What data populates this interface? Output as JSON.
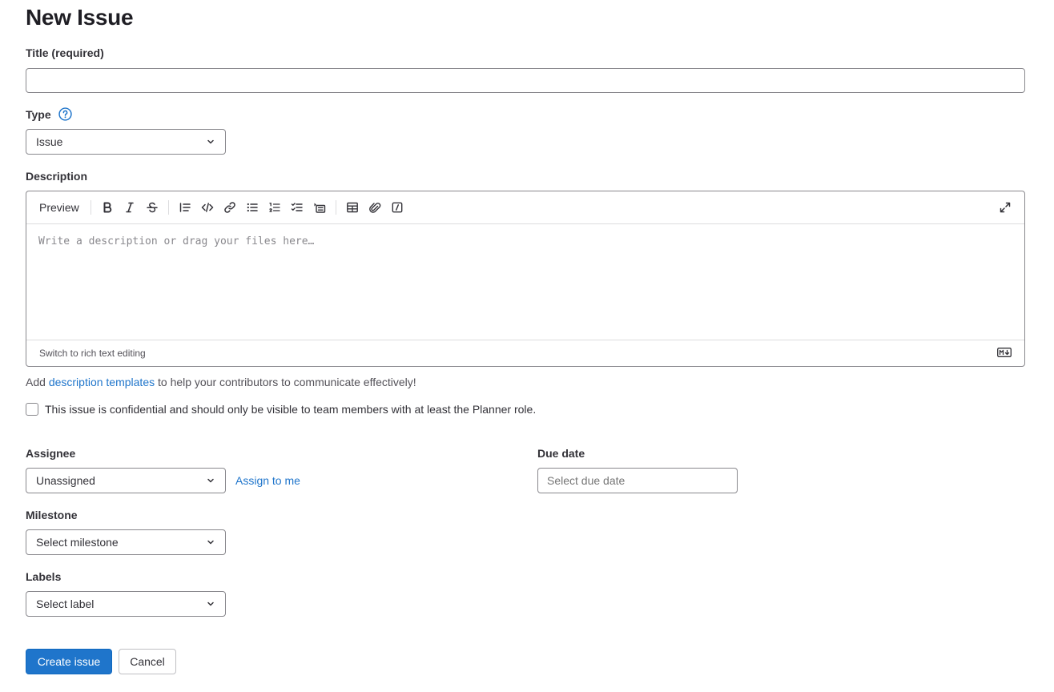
{
  "page": {
    "title": "New Issue"
  },
  "title_field": {
    "label": "Title (required)",
    "value": ""
  },
  "type_field": {
    "label": "Type",
    "help_icon": "question-circle-icon",
    "selected": "Issue"
  },
  "description": {
    "label": "Description",
    "toolbar": {
      "preview_label": "Preview",
      "icons": [
        "bold-icon",
        "italic-icon",
        "strikethrough-icon",
        "quote-icon",
        "code-icon",
        "link-icon",
        "bulleted-list-icon",
        "numbered-list-icon",
        "task-list-icon",
        "collapsible-section-icon",
        "table-icon",
        "attach-file-icon",
        "slash-command-icon",
        "maximize-icon"
      ]
    },
    "placeholder": "Write a description or drag your files here…",
    "footer_left": "Switch to rich text editing",
    "footer_right_icon": "markdown-icon"
  },
  "templates_hint": {
    "before": "Add ",
    "link": "description templates",
    "after": " to help your contributors to communicate effectively!"
  },
  "confidential": {
    "checked": false,
    "label": "This issue is confidential and should only be visible to team members with at least the Planner role."
  },
  "assignee": {
    "label": "Assignee",
    "selected": "Unassigned",
    "assign_to_me": "Assign to me"
  },
  "due_date": {
    "label": "Due date",
    "placeholder": "Select due date",
    "value": ""
  },
  "milestone": {
    "label": "Milestone",
    "selected": "Select milestone"
  },
  "labels": {
    "label": "Labels",
    "selected": "Select label"
  },
  "actions": {
    "create": "Create issue",
    "cancel": "Cancel"
  },
  "colors": {
    "primary": "#1f75cb",
    "link": "#1f75cb",
    "border": "#89888d",
    "text": "#333238"
  }
}
